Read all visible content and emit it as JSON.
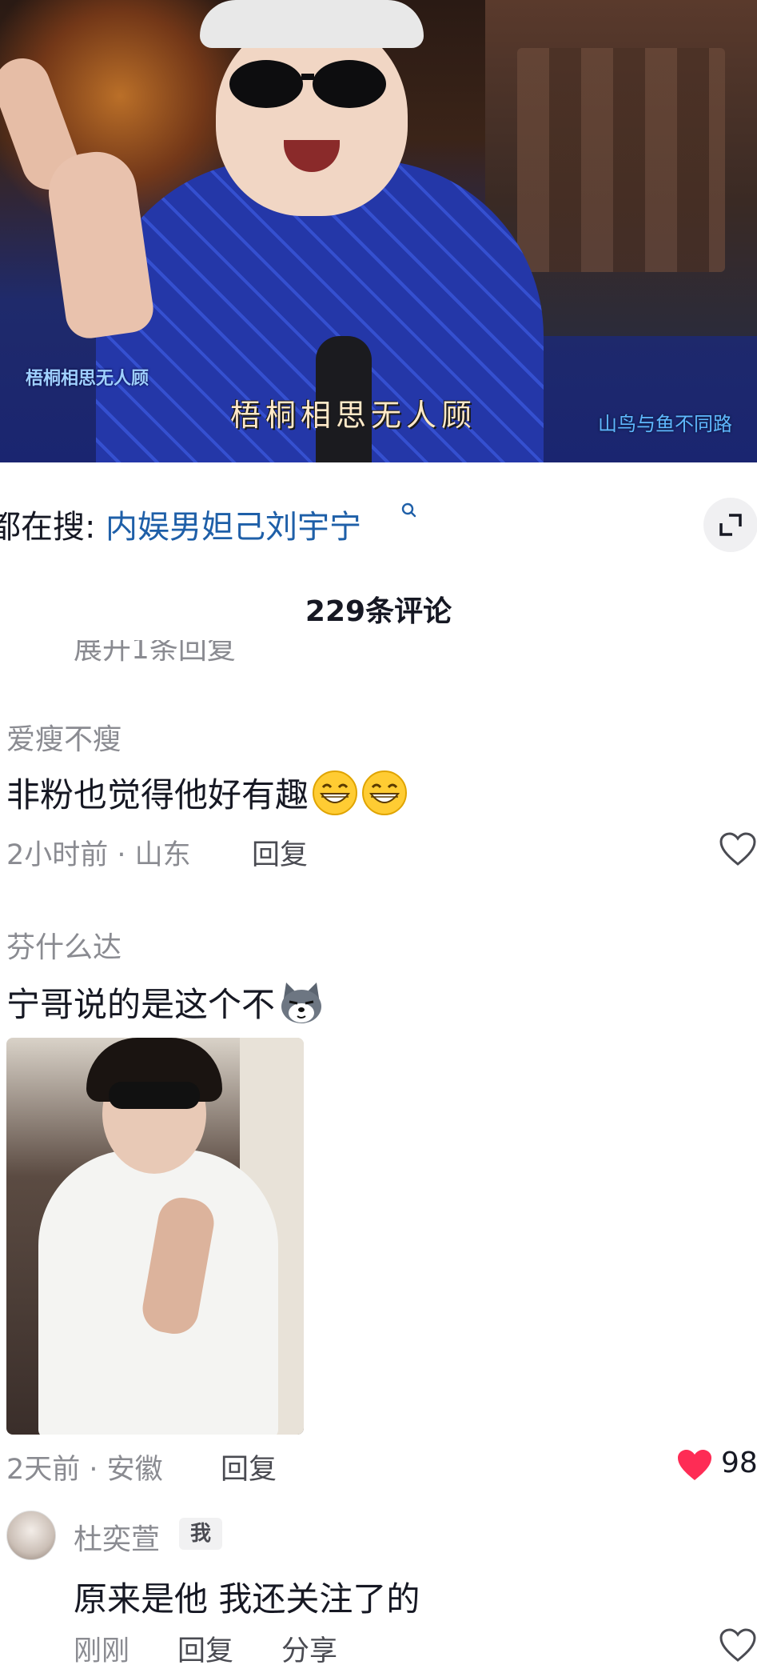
{
  "video": {
    "watermark_left": "梧桐相思无人顾",
    "subtitle": "梧桐相思无人顾",
    "watermark_right": "山鸟与鱼不同路"
  },
  "search": {
    "prefix": "都在搜:",
    "term": "内娱男妲己刘宇宁",
    "search_icon": "search-icon",
    "expand_icon": "expand-icon"
  },
  "comments_header": {
    "count_label": "229条评论"
  },
  "collapsed_reply": "展开1条回复",
  "comments": [
    {
      "username": "爱瘦不瘦",
      "text": "非粉也觉得他好有趣",
      "emoji": [
        "grin-emoji",
        "grin-emoji"
      ],
      "time_location": "2小时前 · 山东",
      "reply_label": "回复",
      "liked": false
    },
    {
      "username": "芬什么达",
      "text": "宁哥说的是这个不",
      "emoji": [
        "husky-emoji"
      ],
      "has_image": true,
      "time_location": "2天前 · 安徽",
      "reply_label": "回复",
      "liked": true,
      "like_count": "98"
    },
    {
      "username": "杜奕萱",
      "badge": "我",
      "text": "原来是他 我还关注了的",
      "time_location": "刚刚",
      "reply_label": "回复",
      "share_label": "分享",
      "liked": false
    }
  ],
  "colors": {
    "link": "#1e5fa8",
    "muted": "#8a8b91",
    "like_red": "#fe2c55"
  }
}
